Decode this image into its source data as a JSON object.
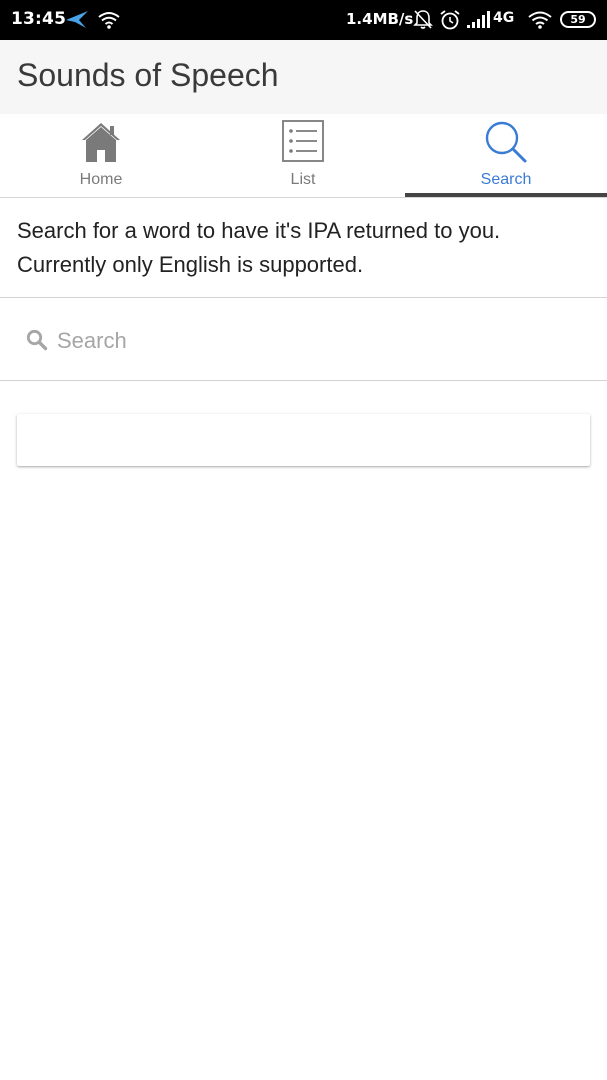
{
  "status_bar": {
    "time": "13:45",
    "net_speed": "1.4MB/s",
    "network_type": "4G",
    "battery_level": "59",
    "icons": [
      "bird-icon",
      "wifi-icon",
      "bell-muted-icon",
      "alarm-icon",
      "signal-icon",
      "wifi-icon",
      "battery-icon"
    ]
  },
  "app": {
    "title": "Sounds of Speech"
  },
  "tabs": [
    {
      "label": "Home",
      "icon": "home-icon",
      "active": false
    },
    {
      "label": "List",
      "icon": "list-icon",
      "active": false
    },
    {
      "label": "Search",
      "icon": "search-icon",
      "active": true
    }
  ],
  "colors": {
    "accent": "#3a7bd5",
    "inactive_tab": "#7a7a7a",
    "indicator": "#444444",
    "app_bar_bg": "#f6f6f6",
    "status_bar_bg": "#000000"
  },
  "search_page": {
    "description": "Search for a word to have it's IPA returned to you. Currently only English is supported.",
    "search_placeholder": "Search",
    "search_value": ""
  }
}
